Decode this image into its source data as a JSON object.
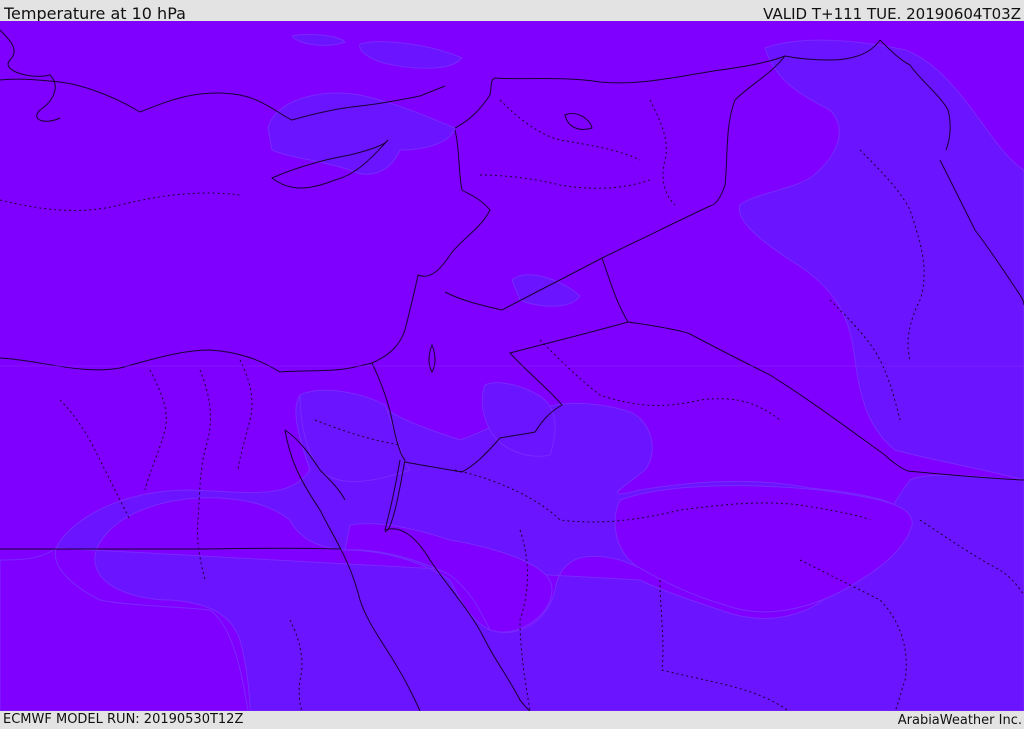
{
  "header": {
    "title": "Temperature at 10 hPa",
    "valid_time": "VALID T+111 TUE. 20190604T03Z"
  },
  "footer": {
    "model_run": "ECMWF MODEL RUN: 20190530T12Z",
    "credit": "ArabiaWeather Inc."
  },
  "map": {
    "colors": {
      "background_field": "#7f00ff",
      "cooler_field": "#6a14ff",
      "coastline": "#1a0033",
      "borders": "#1a0033"
    }
  }
}
